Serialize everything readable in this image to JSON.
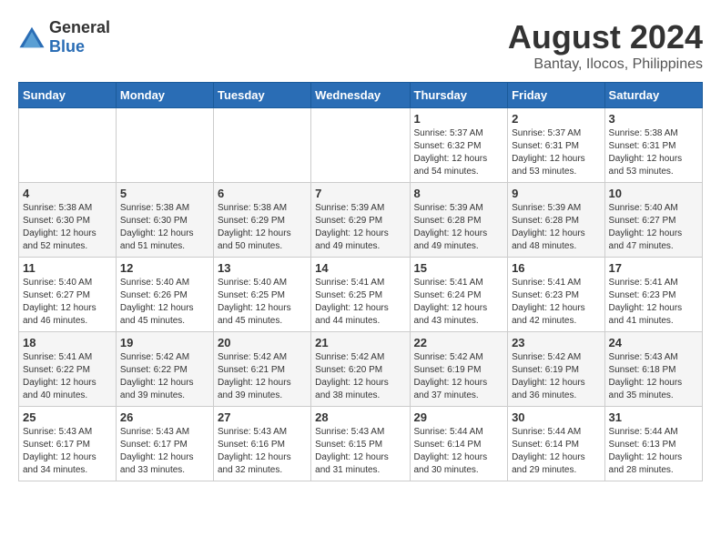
{
  "header": {
    "logo_general": "General",
    "logo_blue": "Blue",
    "month_year": "August 2024",
    "location": "Bantay, Ilocos, Philippines"
  },
  "days_of_week": [
    "Sunday",
    "Monday",
    "Tuesday",
    "Wednesday",
    "Thursday",
    "Friday",
    "Saturday"
  ],
  "weeks": [
    [
      null,
      null,
      null,
      null,
      {
        "day": 1,
        "sunrise": "5:37 AM",
        "sunset": "6:32 PM",
        "daylight": "12 hours and 54 minutes."
      },
      {
        "day": 2,
        "sunrise": "5:37 AM",
        "sunset": "6:31 PM",
        "daylight": "12 hours and 53 minutes."
      },
      {
        "day": 3,
        "sunrise": "5:38 AM",
        "sunset": "6:31 PM",
        "daylight": "12 hours and 53 minutes."
      }
    ],
    [
      {
        "day": 4,
        "sunrise": "5:38 AM",
        "sunset": "6:30 PM",
        "daylight": "12 hours and 52 minutes."
      },
      {
        "day": 5,
        "sunrise": "5:38 AM",
        "sunset": "6:30 PM",
        "daylight": "12 hours and 51 minutes."
      },
      {
        "day": 6,
        "sunrise": "5:38 AM",
        "sunset": "6:29 PM",
        "daylight": "12 hours and 50 minutes."
      },
      {
        "day": 7,
        "sunrise": "5:39 AM",
        "sunset": "6:29 PM",
        "daylight": "12 hours and 49 minutes."
      },
      {
        "day": 8,
        "sunrise": "5:39 AM",
        "sunset": "6:28 PM",
        "daylight": "12 hours and 49 minutes."
      },
      {
        "day": 9,
        "sunrise": "5:39 AM",
        "sunset": "6:28 PM",
        "daylight": "12 hours and 48 minutes."
      },
      {
        "day": 10,
        "sunrise": "5:40 AM",
        "sunset": "6:27 PM",
        "daylight": "12 hours and 47 minutes."
      }
    ],
    [
      {
        "day": 11,
        "sunrise": "5:40 AM",
        "sunset": "6:27 PM",
        "daylight": "12 hours and 46 minutes."
      },
      {
        "day": 12,
        "sunrise": "5:40 AM",
        "sunset": "6:26 PM",
        "daylight": "12 hours and 45 minutes."
      },
      {
        "day": 13,
        "sunrise": "5:40 AM",
        "sunset": "6:25 PM",
        "daylight": "12 hours and 45 minutes."
      },
      {
        "day": 14,
        "sunrise": "5:41 AM",
        "sunset": "6:25 PM",
        "daylight": "12 hours and 44 minutes."
      },
      {
        "day": 15,
        "sunrise": "5:41 AM",
        "sunset": "6:24 PM",
        "daylight": "12 hours and 43 minutes."
      },
      {
        "day": 16,
        "sunrise": "5:41 AM",
        "sunset": "6:23 PM",
        "daylight": "12 hours and 42 minutes."
      },
      {
        "day": 17,
        "sunrise": "5:41 AM",
        "sunset": "6:23 PM",
        "daylight": "12 hours and 41 minutes."
      }
    ],
    [
      {
        "day": 18,
        "sunrise": "5:41 AM",
        "sunset": "6:22 PM",
        "daylight": "12 hours and 40 minutes."
      },
      {
        "day": 19,
        "sunrise": "5:42 AM",
        "sunset": "6:22 PM",
        "daylight": "12 hours and 39 minutes."
      },
      {
        "day": 20,
        "sunrise": "5:42 AM",
        "sunset": "6:21 PM",
        "daylight": "12 hours and 39 minutes."
      },
      {
        "day": 21,
        "sunrise": "5:42 AM",
        "sunset": "6:20 PM",
        "daylight": "12 hours and 38 minutes."
      },
      {
        "day": 22,
        "sunrise": "5:42 AM",
        "sunset": "6:19 PM",
        "daylight": "12 hours and 37 minutes."
      },
      {
        "day": 23,
        "sunrise": "5:42 AM",
        "sunset": "6:19 PM",
        "daylight": "12 hours and 36 minutes."
      },
      {
        "day": 24,
        "sunrise": "5:43 AM",
        "sunset": "6:18 PM",
        "daylight": "12 hours and 35 minutes."
      }
    ],
    [
      {
        "day": 25,
        "sunrise": "5:43 AM",
        "sunset": "6:17 PM",
        "daylight": "12 hours and 34 minutes."
      },
      {
        "day": 26,
        "sunrise": "5:43 AM",
        "sunset": "6:17 PM",
        "daylight": "12 hours and 33 minutes."
      },
      {
        "day": 27,
        "sunrise": "5:43 AM",
        "sunset": "6:16 PM",
        "daylight": "12 hours and 32 minutes."
      },
      {
        "day": 28,
        "sunrise": "5:43 AM",
        "sunset": "6:15 PM",
        "daylight": "12 hours and 31 minutes."
      },
      {
        "day": 29,
        "sunrise": "5:44 AM",
        "sunset": "6:14 PM",
        "daylight": "12 hours and 30 minutes."
      },
      {
        "day": 30,
        "sunrise": "5:44 AM",
        "sunset": "6:14 PM",
        "daylight": "12 hours and 29 minutes."
      },
      {
        "day": 31,
        "sunrise": "5:44 AM",
        "sunset": "6:13 PM",
        "daylight": "12 hours and 28 minutes."
      }
    ]
  ]
}
